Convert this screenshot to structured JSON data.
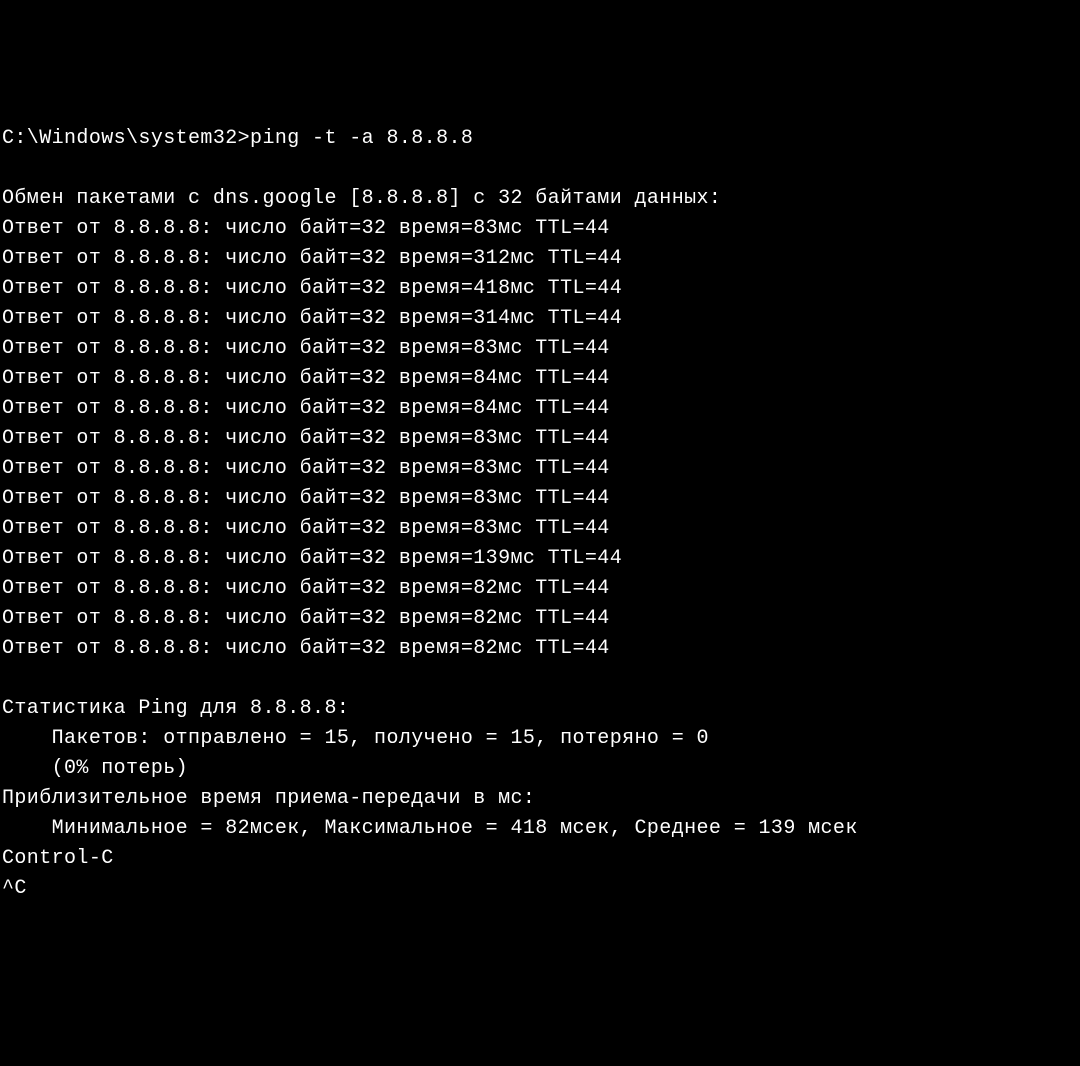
{
  "prompt": {
    "path": "C:\\Windows\\system32>",
    "command": "ping -t -a 8.8.8.8"
  },
  "exchange_header": "Обмен пакетами с dns.google [8.8.8.8] с 32 байтами данных:",
  "replies": [
    "Ответ от 8.8.8.8: число байт=32 время=83мс TTL=44",
    "Ответ от 8.8.8.8: число байт=32 время=312мс TTL=44",
    "Ответ от 8.8.8.8: число байт=32 время=418мс TTL=44",
    "Ответ от 8.8.8.8: число байт=32 время=314мс TTL=44",
    "Ответ от 8.8.8.8: число байт=32 время=83мс TTL=44",
    "Ответ от 8.8.8.8: число байт=32 время=84мс TTL=44",
    "Ответ от 8.8.8.8: число байт=32 время=84мс TTL=44",
    "Ответ от 8.8.8.8: число байт=32 время=83мс TTL=44",
    "Ответ от 8.8.8.8: число байт=32 время=83мс TTL=44",
    "Ответ от 8.8.8.8: число байт=32 время=83мс TTL=44",
    "Ответ от 8.8.8.8: число байт=32 время=83мс TTL=44",
    "Ответ от 8.8.8.8: число байт=32 время=139мс TTL=44",
    "Ответ от 8.8.8.8: число байт=32 время=82мс TTL=44",
    "Ответ от 8.8.8.8: число байт=32 время=82мс TTL=44",
    "Ответ от 8.8.8.8: число байт=32 время=82мс TTL=44"
  ],
  "stats_header": "Статистика Ping для 8.8.8.8:",
  "stats_packets": "    Пакетов: отправлено = 15, получено = 15, потеряно = 0",
  "stats_loss": "    (0% потерь)",
  "stats_time_header": "Приблизительное время приема-передачи в мс:",
  "stats_time_values": "    Минимальное = 82мсек, Максимальное = 418 мсек, Среднее = 139 мсек",
  "ctrl_c": "Control-C",
  "caret_c": "^C"
}
